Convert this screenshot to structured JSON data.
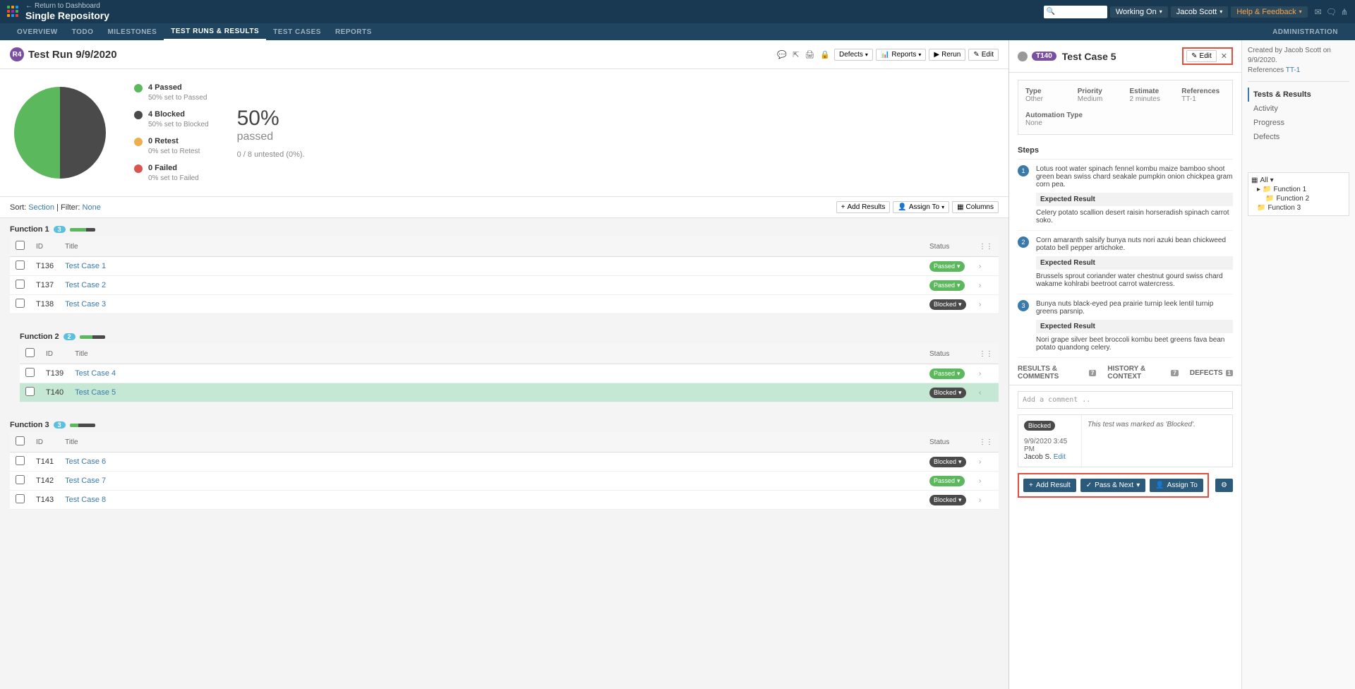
{
  "topbar": {
    "return": "Return to Dashboard",
    "title": "Single Repository",
    "working_on": "Working On",
    "user": "Jacob Scott",
    "help": "Help & Feedback"
  },
  "nav": {
    "overview": "OVERVIEW",
    "todo": "TODO",
    "milestones": "MILESTONES",
    "testruns": "TEST RUNS & RESULTS",
    "testcases": "TEST CASES",
    "reports": "REPORTS",
    "admin": "ADMINISTRATION"
  },
  "run": {
    "badge": "R4",
    "title": "Test Run 9/9/2020",
    "defects": "Defects",
    "reports_btn": "Reports",
    "rerun": "Rerun",
    "edit": "Edit"
  },
  "summary": {
    "passed": "4 Passed",
    "passed_sub": "50% set to Passed",
    "blocked": "4 Blocked",
    "blocked_sub": "50% set to Blocked",
    "retest": "0 Retest",
    "retest_sub": "0% set to Retest",
    "failed": "0 Failed",
    "failed_sub": "0% set to Failed",
    "pct": "50%",
    "pct_label": "passed",
    "untested": "0 / 8 untested (0%)."
  },
  "filter": {
    "sort_label": "Sort:",
    "sort_val": "Section",
    "filter_label": "Filter:",
    "filter_val": "None",
    "add_results": "Add Results",
    "assign_to": "Assign To",
    "columns": "Columns"
  },
  "cols": {
    "id": "ID",
    "title": "Title",
    "status": "Status"
  },
  "sections": {
    "f1": {
      "name": "Function 1",
      "count": "3"
    },
    "f2": {
      "name": "Function 2",
      "count": "2"
    },
    "f3": {
      "name": "Function 3",
      "count": "3"
    }
  },
  "rows": {
    "r1": {
      "id": "T136",
      "title": "Test Case 1",
      "status": "Passed"
    },
    "r2": {
      "id": "T137",
      "title": "Test Case 2",
      "status": "Passed"
    },
    "r3": {
      "id": "T138",
      "title": "Test Case 3",
      "status": "Blocked"
    },
    "r4": {
      "id": "T139",
      "title": "Test Case 4",
      "status": "Passed"
    },
    "r5": {
      "id": "T140",
      "title": "Test Case 5",
      "status": "Blocked"
    },
    "r6": {
      "id": "T141",
      "title": "Test Case 6",
      "status": "Blocked"
    },
    "r7": {
      "id": "T142",
      "title": "Test Case 7",
      "status": "Passed"
    },
    "r8": {
      "id": "T143",
      "title": "Test Case 8",
      "status": "Blocked"
    }
  },
  "detail": {
    "badge": "T140",
    "title": "Test Case 5",
    "edit": "Edit",
    "meta": {
      "type_l": "Type",
      "type": "Other",
      "priority_l": "Priority",
      "priority": "Medium",
      "estimate_l": "Estimate",
      "estimate": "2 minutes",
      "refs_l": "References",
      "refs": "TT-1",
      "auto_l": "Automation Type",
      "auto": "None"
    },
    "steps_title": "Steps",
    "steps": {
      "s1": {
        "n": "1",
        "desc": "Lotus root water spinach fennel kombu maize bamboo shoot green bean swiss chard seakale pumpkin onion chickpea gram corn pea.",
        "exp": "Celery potato scallion desert raisin horseradish spinach carrot soko."
      },
      "s2": {
        "n": "2",
        "desc": "Corn amaranth salsify bunya nuts nori azuki bean chickweed potato bell pepper artichoke.",
        "exp": "Brussels sprout coriander water chestnut gourd swiss chard wakame kohlrabi beetroot carrot watercress."
      },
      "s3": {
        "n": "3",
        "desc": "Bunya nuts black-eyed pea prairie turnip leek lentil turnip greens parsnip.",
        "exp": "Nori grape silver beet broccoli kombu beet greens fava bean potato quandong celery."
      }
    },
    "expected_label": "Expected Result",
    "tabs": {
      "results": "RESULTS & COMMENTS",
      "results_n": "7",
      "history": "HISTORY & CONTEXT",
      "history_n": "7",
      "defects": "DEFECTS",
      "defects_n": "1"
    },
    "comment_placeholder": "Add a comment ..",
    "result": {
      "status": "Blocked",
      "msg": "This test was marked as 'Blocked'.",
      "date": "9/9/2020 3:45 PM",
      "user": "Jacob S.",
      "edit": "Edit"
    },
    "actions": {
      "add_result": "Add Result",
      "pass_next": "Pass & Next",
      "assign_to": "Assign To"
    }
  },
  "side": {
    "created": "Created by Jacob Scott on 9/9/2020.",
    "refs_label": "References",
    "refs": "TT-1",
    "nav": {
      "tests": "Tests & Results",
      "activity": "Activity",
      "progress": "Progress",
      "defects": "Defects"
    },
    "tree": {
      "all": "All",
      "f1": "Function 1",
      "f2": "Function 2",
      "f3": "Function 3"
    }
  }
}
